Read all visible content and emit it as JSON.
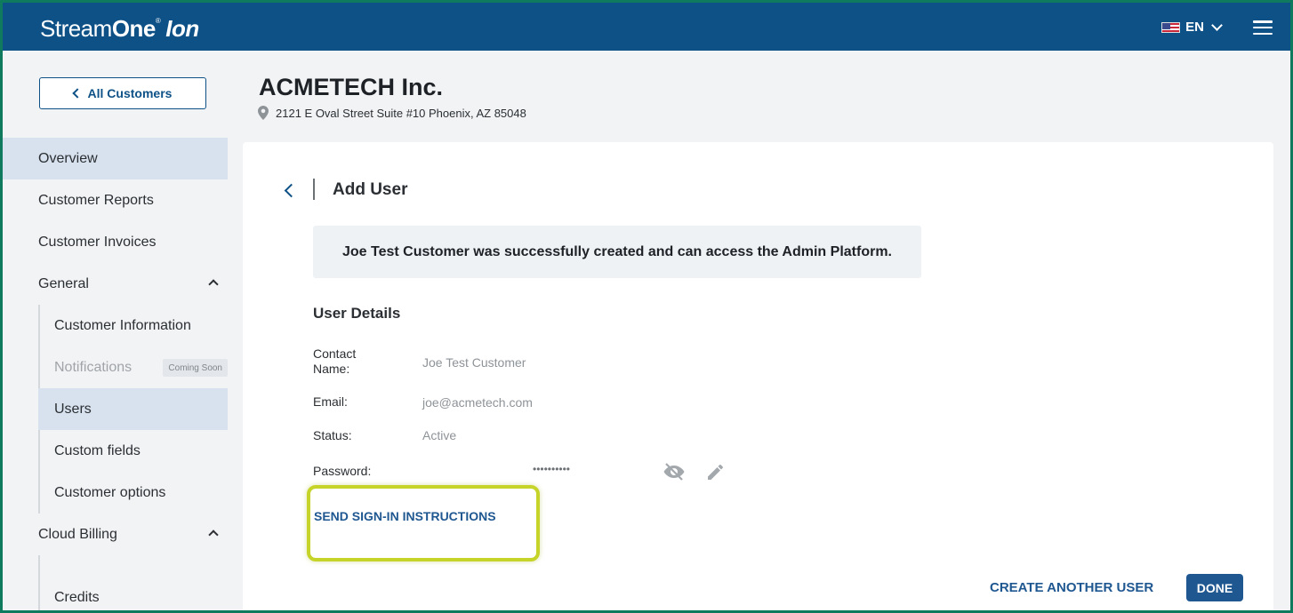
{
  "header": {
    "logo_stream": "Stream",
    "logo_one": "One",
    "logo_reg": "®",
    "logo_ion": "Ion",
    "language": "EN"
  },
  "sidebar": {
    "back_label": "All Customers",
    "items": [
      {
        "label": "Overview"
      },
      {
        "label": "Customer Reports"
      },
      {
        "label": "Customer Invoices"
      },
      {
        "label": "General"
      },
      {
        "label": "Customer Information"
      },
      {
        "label": "Notifications",
        "badge": "Coming Soon"
      },
      {
        "label": "Users"
      },
      {
        "label": "Custom fields"
      },
      {
        "label": "Customer options"
      },
      {
        "label": "Cloud Billing"
      },
      {
        "label": "Credits"
      }
    ]
  },
  "customer": {
    "name": "ACMETECH Inc.",
    "address": "2121 E Oval Street Suite #10 Phoenix, AZ 85048"
  },
  "card": {
    "title": "Add User",
    "success_message": "Joe Test Customer was successfully created and can access the Admin Platform.",
    "section_title": "User Details",
    "fields": {
      "contact_label_1": "Contact",
      "contact_label_2": "Name:",
      "contact_value": "Joe Test Customer",
      "email_label": "Email:",
      "email_value": "joe@acmetech.com",
      "status_label": "Status:",
      "status_value": "Active",
      "password_label": "Password:",
      "password_value": "••••••••••"
    },
    "send_instructions": "SEND SIGN-IN INSTRUCTIONS",
    "create_another": "CREATE ANOTHER USER",
    "done": "DONE"
  },
  "colors": {
    "brand": "#0d5187",
    "link": "#1f5791",
    "highlight": "#c6d42a",
    "active_nav": "#d8e2ee"
  }
}
